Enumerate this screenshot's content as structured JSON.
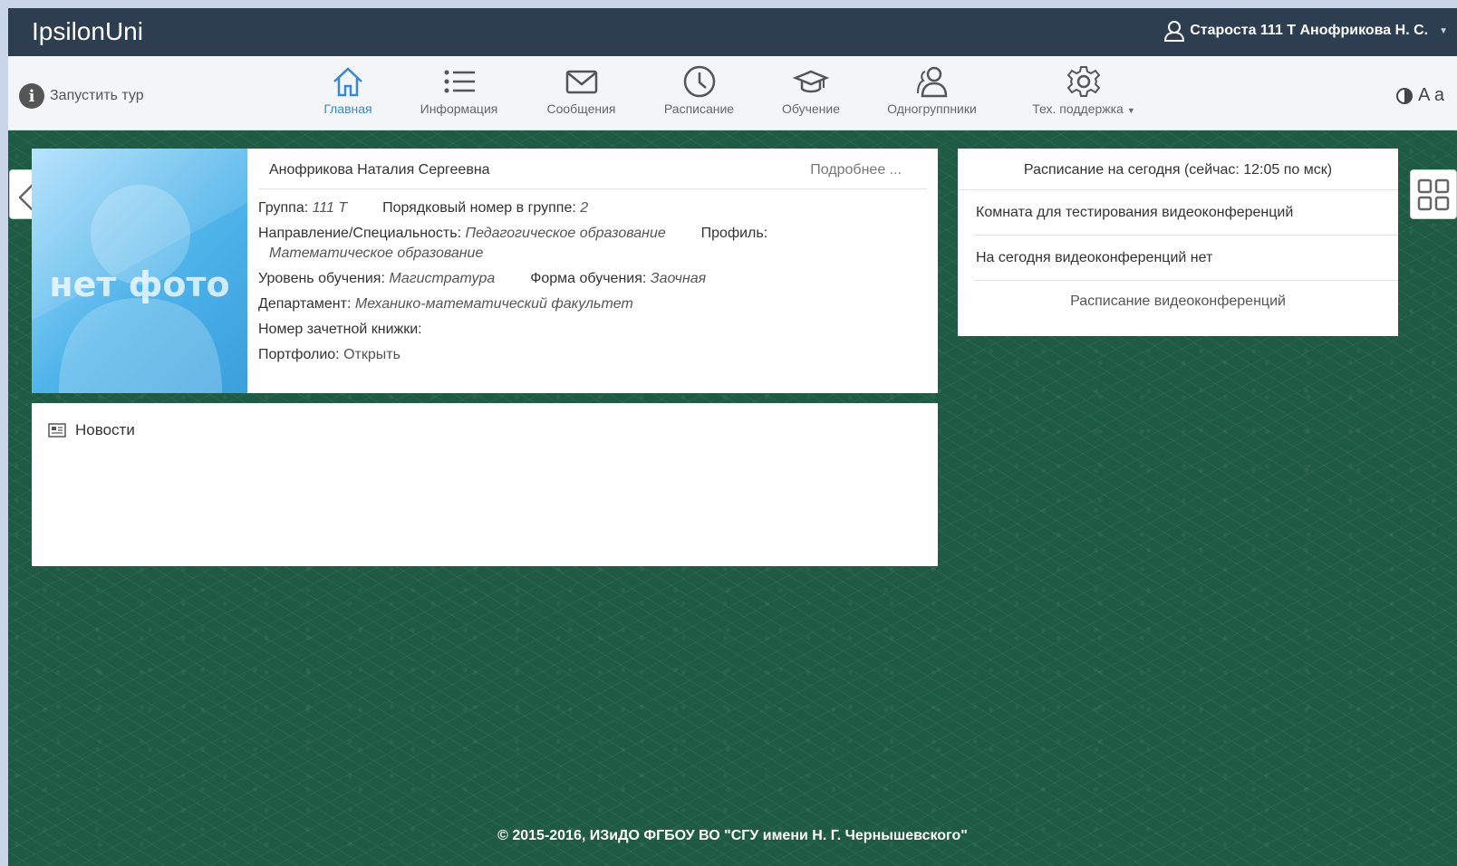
{
  "header": {
    "brand": "IpsilonUni",
    "user_label": "Староста 111 Т Анофрикова Н. С."
  },
  "toolbar": {
    "tour_label": "Запустить тур",
    "font_toggle_label": "A a"
  },
  "nav": {
    "items": [
      {
        "label": "Главная",
        "icon": "home-icon",
        "active": true
      },
      {
        "label": "Информация",
        "icon": "list-icon"
      },
      {
        "label": "Сообщения",
        "icon": "envelope-icon"
      },
      {
        "label": "Расписание",
        "icon": "clock-icon"
      },
      {
        "label": "Обучение",
        "icon": "graduation-cap-icon"
      },
      {
        "label": "Одногруппники",
        "icon": "users-icon"
      },
      {
        "label": "Тех. поддержка",
        "icon": "gear-icon"
      }
    ]
  },
  "profile": {
    "photo_placeholder": "нет фото",
    "full_name": "Анофрикова Наталия Сергеевна",
    "more_link": "Подробнее ...",
    "group_label": "Группа:",
    "group_value": "111 Т",
    "order_label": "Порядковый номер в группе:",
    "order_value": "2",
    "direction_label": "Направление/Специальность:",
    "direction_value": "Педагогическое образование",
    "profile_label": "Профиль:",
    "profile_value": "Математическое образование",
    "level_label": "Уровень обучения:",
    "level_value": "Магистратура",
    "form_label": "Форма обучения:",
    "form_value": "Заочная",
    "department_label": "Департамент:",
    "department_value": "Механико-математический факультет",
    "record_book_label": "Номер зачетной книжки:",
    "portfolio_label": "Портфолио:",
    "portfolio_link": "Открыть"
  },
  "schedule": {
    "title": "Расписание на сегодня  (сейчас: 12:05 по мск)",
    "room_link": "Комната для тестирования видеоконференций",
    "empty_message": "На сегодня видеоконференций нет",
    "all_link": "Расписание видеоконференций"
  },
  "news": {
    "title": "Новости"
  },
  "footer": {
    "text": "© 2015-2016, ИЗиДО ФГБОУ ВО \"СГУ имени Н. Г. Чернышевского\""
  },
  "colors": {
    "topbar": "#2c3e50",
    "background": "#1f5a44",
    "accent": "#3a87d6"
  }
}
